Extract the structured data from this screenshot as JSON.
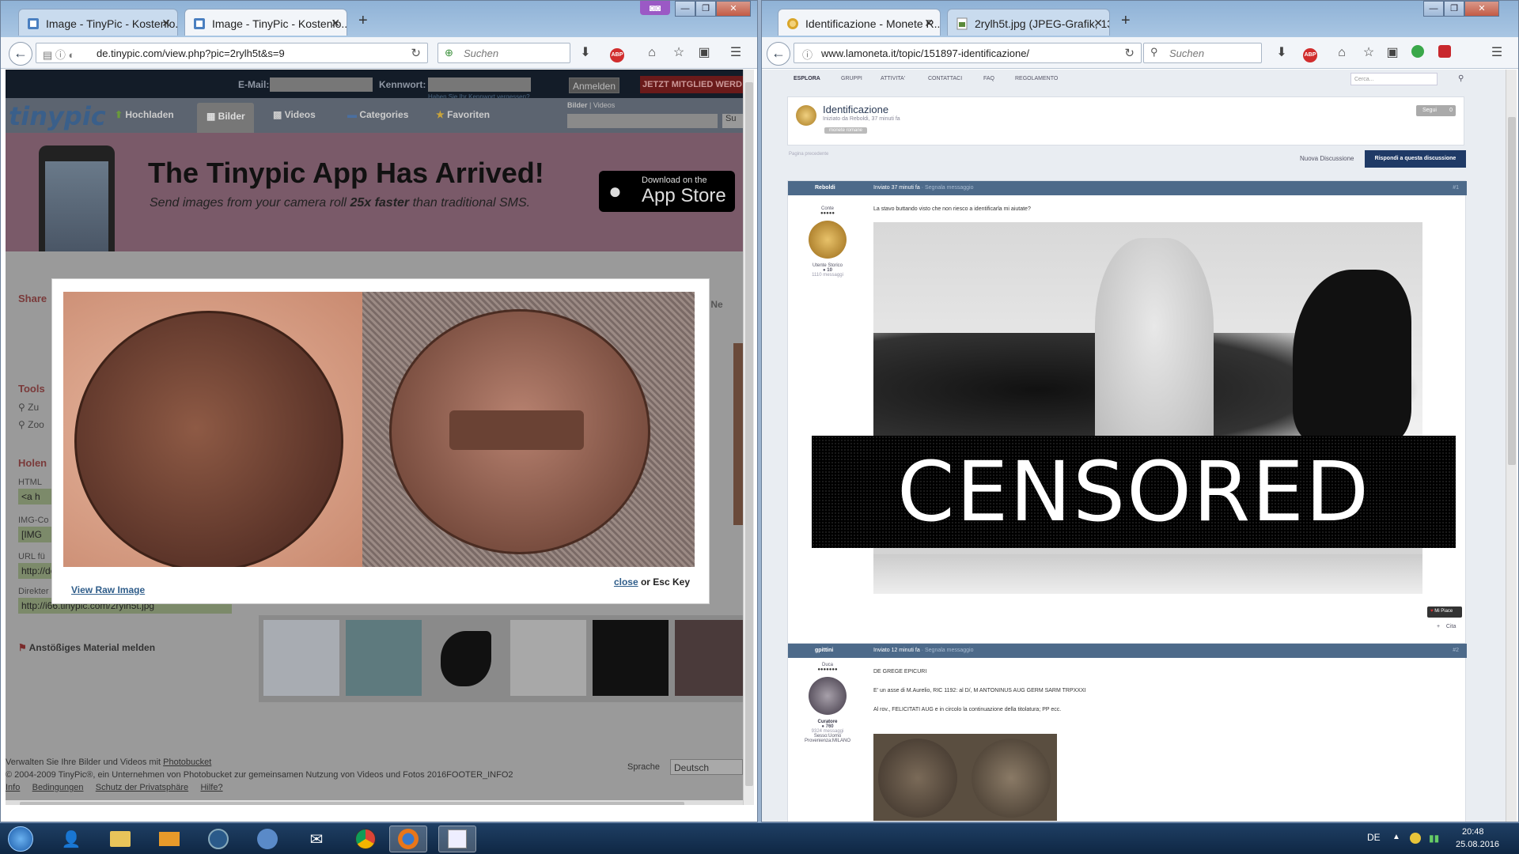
{
  "left_browser": {
    "tabs": [
      {
        "title": "Image - TinyPic - Kostenlo...",
        "active": false
      },
      {
        "title": "Image - TinyPic - Kostenlo...",
        "active": true
      }
    ],
    "url": "de.tinypic.com/view.php?pic=2rylh5t&s=9",
    "search_placeholder": "Suchen",
    "page": {
      "login": {
        "email_label": "E-Mail:",
        "password_label": "Kennwort:",
        "login_button": "Anmelden",
        "join_button": "JETZT MITGLIED WERD",
        "forgot": "Haben Sie Ihr Kennwort vergessen?"
      },
      "logo": "tinypic",
      "nav": [
        "Hochladen",
        "Bilder",
        "Videos",
        "Categories",
        "Favoriten"
      ],
      "search_label": "Bilder",
      "search_sublabel": "Videos",
      "search_button": "Su",
      "banner": {
        "title": "The Tinypic App Has Arrived!",
        "subtitle_pre": "Send images from your camera roll ",
        "subtitle_em": "25x faster",
        "subtitle_post": " than traditional SMS.",
        "store_small": "Download on the",
        "store_big": "App Store"
      },
      "sidebar": {
        "share": "Share",
        "tools": "Tools",
        "tool_items": [
          "Zu",
          "Zoo"
        ],
        "holen": "Holen",
        "html_label": "HTML",
        "html_value": "<a h",
        "img_label": "IMG-Co",
        "img_value": "[IMG",
        "url_label": "URL fü",
        "url_value": "http://de.tinypic.com/r/2rylh5t/9",
        "direct_label": "Direkter Link für Layouts",
        "direct_value": "http://i66.tinypic.com/2rylh5t.jpg",
        "report": "Anstößiges Material melden"
      },
      "right_tabs": [
        "r",
        "Ne"
      ],
      "footer": {
        "line1_pre": "Verwalten Sie Ihre Bilder und Videos mit ",
        "line1_link": "Photobucket",
        "line2": "© 2004-2009 TinyPic®, ein Unternehmen von Photobucket zur gemeinsamen Nutzung von Videos und Fotos 2016FOOTER_INFO2",
        "links": [
          "Info",
          "Bedingungen",
          "Schutz der Privatsphäre",
          "Hilfe?"
        ],
        "language_label": "Sprache",
        "language_value": "Deutsch"
      }
    },
    "lightbox": {
      "view_raw": "View Raw Image",
      "close_link": "close",
      "close_suffix": " or Esc Key"
    }
  },
  "right_browser": {
    "tabs": [
      {
        "title": "Identificazione - Monete R...",
        "active": true
      },
      {
        "title": "2rylh5t.jpg (JPEG-Grafik, 13...",
        "active": false
      }
    ],
    "url": "www.lamoneta.it/topic/151897-identificazione/",
    "search_placeholder": "Suchen",
    "forum": {
      "menu": [
        "ESPLORA",
        "GRUPPI",
        "ATTIVITA'",
        "CONTATTACI",
        "FAQ",
        "REGOLAMENTO"
      ],
      "search_placeholder": "Cerca...",
      "topic_title": "Identificazione",
      "topic_meta": "Iniziato da Reboldi, 37 minuti fa",
      "topic_tag": "monete romane",
      "follow_button": "Segui",
      "follow_count": "0",
      "nuova_discussione": "Nuova Discussione",
      "rispondi": "Rispondi a questa discussione",
      "nav_hint": "Pagina precedente",
      "posts": [
        {
          "author": "Reboldi",
          "header": "Inviato 37 minuti fa",
          "header_extra": " · Segnala messaggio",
          "post_no": "#1",
          "rank": "Conte",
          "stars": "●●●●●",
          "member_title": "Utente Storico",
          "rep": "● 10",
          "msgs": "1110 messaggi",
          "text": "La stavo buttando visto che non riesco a identificarla mi aiutate?",
          "censor": "CENSORED",
          "like_button": "Mi Piace",
          "quote_button": "Cita"
        },
        {
          "author": "gpittini",
          "header": "Inviato 12 minuti fa",
          "header_extra": " · Segnala messaggio",
          "post_no": "#2",
          "rank": "Duca",
          "stars": "●●●●●●●",
          "member_title": "Curatore",
          "rep": "● 760",
          "msgs": "9324 messaggi",
          "location_label": "Sesso:Uomo",
          "location": "Provenienza:MILANO",
          "lines": [
            "DE GREGE EPICURI",
            "E' un asse di M.Aurelio, RIC 1192: al D/, M ANTONINUS AUG GERM SARM TRPXXXI",
            "Al rov., FELICITATI AUG  e in circolo la continuazione della titolatura; PP ecc."
          ]
        }
      ]
    }
  },
  "taskbar": {
    "apps": [
      "start",
      "explorer-person",
      "folder",
      "mail-client",
      "network",
      "messenger",
      "mail",
      "chrome",
      "firefox",
      "screenshot-tool"
    ],
    "language": "DE",
    "time": "20:48",
    "date": "25.08.2016"
  },
  "colors": {
    "forum_header": "#4d6a8a",
    "tinypic_nav": "#1e2f48",
    "banner": "#f2c9da",
    "accent_blue": "#1f4e79"
  }
}
